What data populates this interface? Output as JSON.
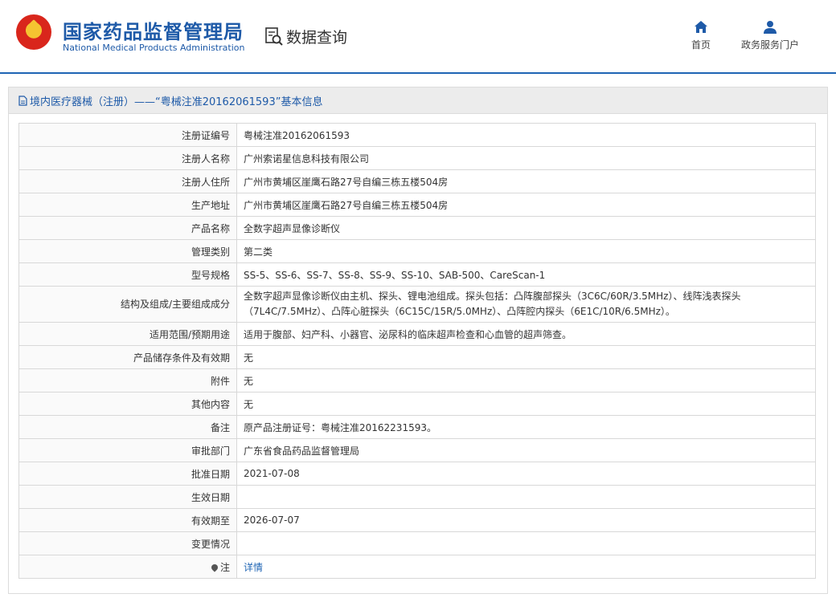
{
  "header": {
    "title": "国家药品监督管理局",
    "subtitle": "National Medical Products Administration",
    "query_label": "数据查询"
  },
  "nav": {
    "home": "首页",
    "portal": "政务服务门户"
  },
  "card": {
    "title": "境内医疗器械（注册）——“粤械注准20162061593”基本信息"
  },
  "rows": [
    {
      "key": "注册证编号",
      "value": "粤械注准20162061593"
    },
    {
      "key": "注册人名称",
      "value": "广州索诺星信息科技有限公司"
    },
    {
      "key": "注册人住所",
      "value": "广州市黄埔区崖鹰石路27号自编三栋五楼504房"
    },
    {
      "key": "生产地址",
      "value": "广州市黄埔区崖鹰石路27号自编三栋五楼504房"
    },
    {
      "key": "产品名称",
      "value": "全数字超声显像诊断仪"
    },
    {
      "key": "管理类别",
      "value": "第二类"
    },
    {
      "key": "型号规格",
      "value": "SS-5、SS-6、SS-7、SS-8、SS-9、SS-10、SAB-500、CareScan-1"
    },
    {
      "key": "结构及组成/主要组成成分",
      "value": "全数字超声显像诊断仪由主机、探头、锂电池组成。探头包括：凸阵腹部探头（3C6C/60R/3.5MHz）、线阵浅表探头（7L4C/7.5MHz）、凸阵心脏探头（6C15C/15R/5.0MHz）、凸阵腔内探头（6E1C/10R/6.5MHz）。"
    },
    {
      "key": "适用范围/预期用途",
      "value": "适用于腹部、妇产科、小器官、泌尿科的临床超声检查和心血管的超声筛查。"
    },
    {
      "key": "产品储存条件及有效期",
      "value": "无"
    },
    {
      "key": "附件",
      "value": "无"
    },
    {
      "key": "其他内容",
      "value": "无"
    },
    {
      "key": "备注",
      "value": "原产品注册证号：粤械注准20162231593。"
    },
    {
      "key": "审批部门",
      "value": "广东省食品药品监督管理局"
    },
    {
      "key": "批准日期",
      "value": "2021-07-08"
    },
    {
      "key": "生效日期",
      "value": ""
    },
    {
      "key": "有效期至",
      "value": "2026-07-07"
    },
    {
      "key": "变更情况",
      "value": ""
    }
  ],
  "note": {
    "key": "注",
    "value": "详情"
  }
}
